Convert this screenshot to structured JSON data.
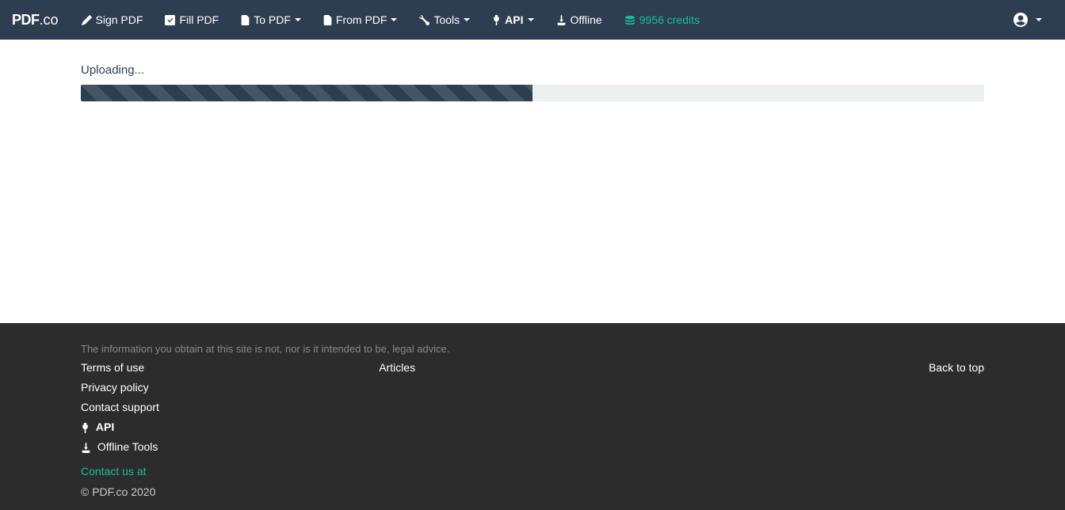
{
  "brand": {
    "pdf": "PDF",
    "co": ".co"
  },
  "nav": {
    "sign": "Sign PDF",
    "fill": "Fill PDF",
    "to_pdf": "To PDF",
    "from_pdf": "From PDF",
    "tools": "Tools",
    "api": "API",
    "offline": "Offline",
    "credits": "9956 credits"
  },
  "main": {
    "uploading": "Uploading...",
    "progress_percent": 50
  },
  "footer": {
    "disclaimer": "The information you obtain at this site is not, nor is it intended to be, legal advice.",
    "terms": "Terms of use",
    "privacy": "Privacy policy",
    "support": "Contact support",
    "api": "API",
    "offline_tools": "Offline Tools",
    "articles": "Articles",
    "back_to_top": "Back to top",
    "contact": "Contact us at",
    "copyright": "© PDF.co 2020"
  }
}
